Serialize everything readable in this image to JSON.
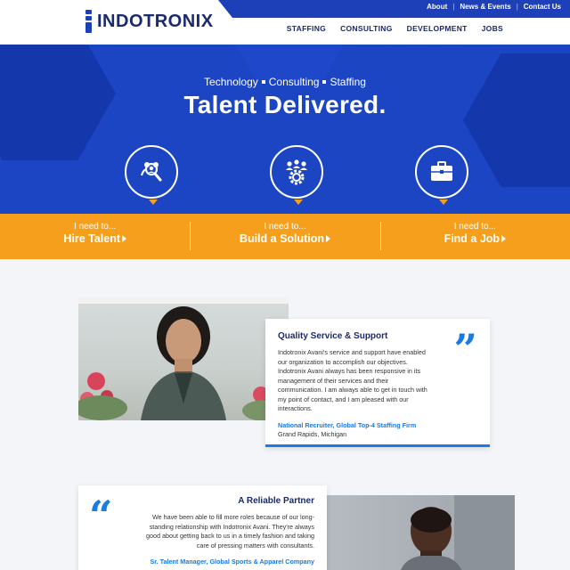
{
  "brand": {
    "name": "INDOTRONIX",
    "colors": {
      "blue": "#1c45c4",
      "navy": "#1a2a6c",
      "orange": "#f59f1d",
      "link": "#1a7be0"
    }
  },
  "topbar": {
    "links": [
      "About",
      "News & Events",
      "Contact Us"
    ]
  },
  "nav": {
    "items": [
      "STAFFING",
      "CONSULTING",
      "DEVELOPMENT",
      "JOBS"
    ]
  },
  "hero": {
    "tagline": [
      "Technology",
      "Consulting",
      "Staffing"
    ],
    "headline": "Talent Delivered.",
    "icons": [
      "talent-search-icon",
      "solution-gear-icon",
      "briefcase-icon"
    ]
  },
  "cta": [
    {
      "small": "I need to...",
      "big": "Hire Talent"
    },
    {
      "small": "I need to...",
      "big": "Build a Solution"
    },
    {
      "small": "I need to...",
      "big": "Find a Job"
    }
  ],
  "testimonials": [
    {
      "title": "Quality Service & Support",
      "body": "Indotronix Avani's service and support have enabled our organization to accomplish our objectives. Indotronix Avani always has been responsive in its management of their services and their communication. I am always able to get in touch with my point of contact, and I am pleased with our interactions.",
      "cite": "National Recruiter, Global Top-4 Staffing Firm",
      "location": "Grand Rapids, Michigan"
    },
    {
      "title": "A Reliable Partner",
      "body": "We have been able to fill more roles because of our long-standing relationship with Indotronix Avani. They're always good about getting back to us in a timely fashion and taking care of pressing matters with consultants.",
      "cite": "Sr. Talent Manager, Global Sports & Apparel Company"
    }
  ]
}
